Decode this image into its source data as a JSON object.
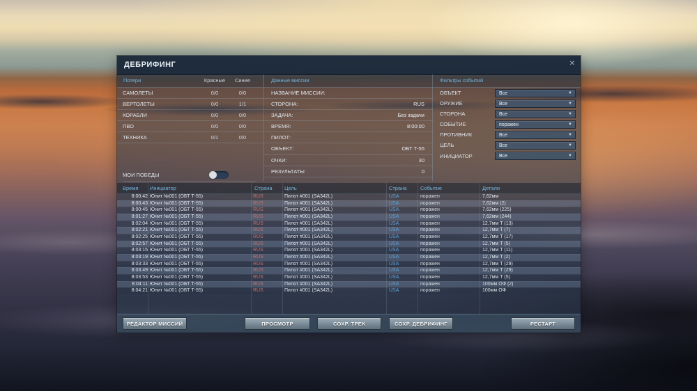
{
  "dialog": {
    "title": "ДЕБРИФИНГ",
    "close_icon": "✕"
  },
  "colors": {
    "accent_header_blue": "#74b2d8",
    "side_red": "#cd6f63",
    "side_blue": "#5ea3d8",
    "titlebar": "#1a2839",
    "panel_bg": "#29394b",
    "button_face": "#7e8e9a"
  },
  "losses": {
    "header": "Потери",
    "col_red": "Красные",
    "col_blue": "Синие",
    "rows": [
      {
        "label": "САМОЛЕТЫ",
        "red": "0/0",
        "blue": "0/0"
      },
      {
        "label": "ВЕРТОЛЕТЫ",
        "red": "0/0",
        "blue": "1/1"
      },
      {
        "label": "КОРАБЛИ",
        "red": "0/0",
        "blue": "0/0"
      },
      {
        "label": "ПВО",
        "red": "0/0",
        "blue": "0/0"
      },
      {
        "label": "ТЕХНИКА",
        "red": "0/1",
        "blue": "0/0"
      }
    ],
    "my_victories_label": "МОИ ПОБЕДЫ",
    "my_victories_on": false
  },
  "mission": {
    "header": "Данные миссии",
    "rows": [
      {
        "label": "НАЗВАНИЕ МИССИИ:",
        "value": ""
      },
      {
        "label": "СТОРОНА:",
        "value": "RUS"
      },
      {
        "label": "ЗАДАЧА:",
        "value": "Без задачи"
      },
      {
        "label": "ВРЕМЯ:",
        "value": "8:00:00"
      },
      {
        "label": "ПИЛОТ:",
        "value": ""
      },
      {
        "label": "ОБЪЕКТ:",
        "value": "ОБТ Т-55"
      },
      {
        "label": "ОЧКИ:",
        "value": "30"
      },
      {
        "label": "РЕЗУЛЬТАТЫ",
        "value": "0"
      }
    ]
  },
  "filters": {
    "header": "Фильтры событий",
    "dropdown_arrow": "▼",
    "rows": [
      {
        "label": "ОБЪЕКТ",
        "value": "Все"
      },
      {
        "label": "ОРУЖИЕ",
        "value": "Все"
      },
      {
        "label": "СТОРОНА",
        "value": "Все"
      },
      {
        "label": "СОБЫТИЕ",
        "value": "поражен"
      },
      {
        "label": "ПРОТИВНИК",
        "value": "Все"
      },
      {
        "label": "ЦЕЛЬ",
        "value": "Все"
      },
      {
        "label": "ИНИЦИАТОР",
        "value": "Все"
      }
    ]
  },
  "events_table": {
    "columns": [
      "Время",
      "Инициатор",
      "Страна",
      "Цель",
      "Страна",
      "Событие",
      "Детали"
    ],
    "rows": [
      [
        "8:00:42",
        "Юнит №001 (ОБТ Т-55)",
        "RUS",
        "Пилот #001 (SA342L)",
        "USA",
        "поражен",
        "7,62мм"
      ],
      [
        "8:00:43",
        "Юнит №001 (ОБТ Т-55)",
        "RUS",
        "Пилот #001 (SA342L)",
        "USA",
        "поражен",
        "7,62мм (2)"
      ],
      [
        "8:00:45",
        "Юнит №001 (ОБТ Т-55)",
        "RUS",
        "Пилот #001 (SA342L)",
        "USA",
        "поражен",
        "7,62мм (225)"
      ],
      [
        "8:01:27",
        "Юнит №001 (ОБТ Т-55)",
        "RUS",
        "Пилот #001 (SA342L)",
        "USA",
        "поражен",
        "7,62мм (244)"
      ],
      [
        "8:02:04",
        "Юнит №001 (ОБТ Т-55)",
        "RUS",
        "Пилот #001 (SA342L)",
        "USA",
        "поражен",
        "12,7мм Т (13)"
      ],
      [
        "8:02:21",
        "Юнит №001 (ОБТ Т-55)",
        "RUS",
        "Пилот #001 (SA342L)",
        "USA",
        "поражен",
        "12,7мм Т (7)"
      ],
      [
        "8:02:25",
        "Юнит №001 (ОБТ Т-55)",
        "RUS",
        "Пилот #001 (SA342L)",
        "USA",
        "поражен",
        "12,7мм Т (17)"
      ],
      [
        "8:02:57",
        "Юнит №001 (ОБТ Т-55)",
        "RUS",
        "Пилот #001 (SA342L)",
        "USA",
        "поражен",
        "12,7мм Т (5)"
      ],
      [
        "8:03:15",
        "Юнит №001 (ОБТ Т-55)",
        "RUS",
        "Пилот #001 (SA342L)",
        "USA",
        "поражен",
        "12,7мм Т (11)"
      ],
      [
        "8:03:19",
        "Юнит №001 (ОБТ Т-55)",
        "RUS",
        "Пилот #001 (SA342L)",
        "USA",
        "поражен",
        "12,7мм Т (2)"
      ],
      [
        "8:03:33",
        "Юнит №001 (ОБТ Т-55)",
        "RUS",
        "Пилот #001 (SA342L)",
        "USA",
        "поражен",
        "12,7мм Т (29)"
      ],
      [
        "8:03:49",
        "Юнит №001 (ОБТ Т-55)",
        "RUS",
        "Пилот #001 (SA342L)",
        "USA",
        "поражен",
        "12,7мм Т (29)"
      ],
      [
        "8:03:53",
        "Юнит №001 (ОБТ Т-55)",
        "RUS",
        "Пилот #001 (SA342L)",
        "USA",
        "поражен",
        "12,7мм Т (5)"
      ],
      [
        "8:04:11",
        "Юнит №001 (ОБТ Т-55)",
        "RUS",
        "Пилот #001 (SA342L)",
        "USA",
        "поражен",
        "100мм ОФ (2)"
      ],
      [
        "8:04:21",
        "Юнит №001 (ОБТ Т-55)",
        "RUS",
        "Пилот #001 (SA342L)",
        "USA",
        "поражен",
        "100мм ОФ"
      ]
    ]
  },
  "footer": {
    "buttons": [
      "РЕДАКТОР МИССИЙ",
      "ПРОСМОТР",
      "СОХР. ТРЕК",
      "СОХР. ДЕБРИФИНГ",
      "РЕСТАРТ"
    ]
  }
}
